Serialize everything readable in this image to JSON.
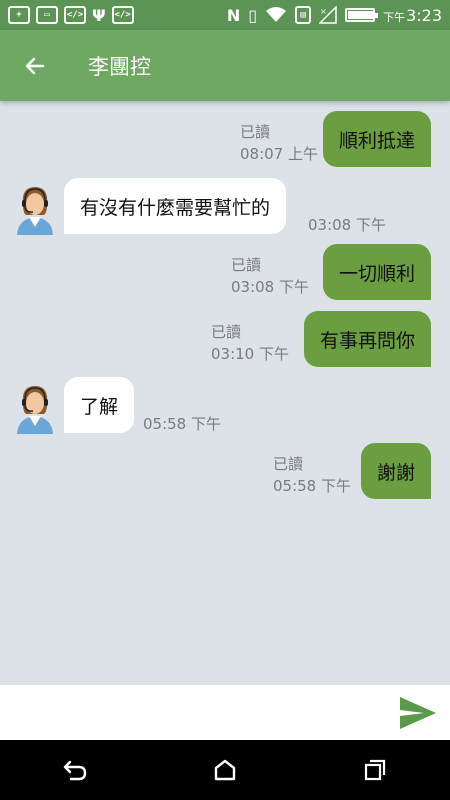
{
  "status_bar": {
    "icons": [
      "add-box-icon",
      "image-icon",
      "code-icon",
      "usb-icon",
      "code-icon",
      "nfc-icon",
      "vibrate-icon",
      "wifi-icon",
      "sim-icon",
      "no-signal-icon",
      "battery-icon"
    ],
    "time_prefix": "下午",
    "time": "3:23",
    "battery_level": 0.95
  },
  "app_bar": {
    "title": "李團控",
    "back_icon": "arrow-left-icon"
  },
  "messages": [
    {
      "direction": "outgoing",
      "text": "順利抵達",
      "read": "已讀",
      "time": "08:07 上午"
    },
    {
      "direction": "incoming",
      "text": "有沒有什麼需要幫忙的",
      "time": "03:08 下午"
    },
    {
      "direction": "outgoing",
      "text": "一切順利",
      "read": "已讀",
      "time": "03:08 下午"
    },
    {
      "direction": "outgoing",
      "text": "有事再問你",
      "read": "已讀",
      "time": "03:10 下午"
    },
    {
      "direction": "incoming",
      "text": "了解",
      "time": "05:58 下午"
    },
    {
      "direction": "outgoing",
      "text": "謝謝",
      "read": "已讀",
      "time": "05:58 下午"
    }
  ],
  "input": {
    "value": "",
    "placeholder": "",
    "send_icon": "send-icon"
  },
  "nav_bar": {
    "icons": [
      "back-nav-icon",
      "home-icon",
      "recents-icon"
    ]
  },
  "colors": {
    "status_bar": "#5c9456",
    "app_bar": "#6fa863",
    "outgoing_bubble": "#6b9e41",
    "chat_background": "#dde2e9",
    "send_icon": "#5a9a4a"
  }
}
